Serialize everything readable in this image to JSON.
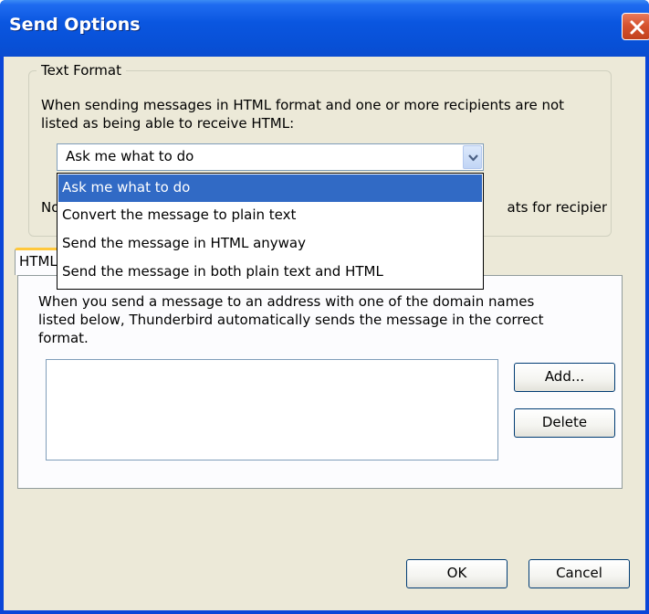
{
  "window": {
    "title": "Send Options",
    "colors": {
      "titlebar": "#0a56e0",
      "face": "#ece9d8",
      "selection": "#316ac5",
      "close": "#d6532f"
    }
  },
  "text_format": {
    "legend": "Text Format",
    "description_line1": "When sending messages in HTML format and one or more recipients are not",
    "description_line2": "listed as being able to receive HTML:",
    "combo_value": "Ask me what to do",
    "note_prefix": "Note",
    "note_suffix": "ats for recipients.",
    "options": [
      "Ask me what to do",
      "Convert the message to plain text",
      "Send the message in HTML anyway",
      "Send the message in both plain text and HTML"
    ],
    "selected_option": "Ask me what to do"
  },
  "tabs": {
    "active_label": "HTML D"
  },
  "domain_panel": {
    "description_line1": "When you send a message to an address with one of the domain names",
    "description_line2": "listed below, Thunderbird automatically sends the message in the correct",
    "description_line3": "format.",
    "add_label": "Add...",
    "delete_label": "Delete",
    "domains": []
  },
  "footer": {
    "ok_label": "OK",
    "cancel_label": "Cancel"
  },
  "icons": {
    "close": "close-icon",
    "dropdown": "chevron-down-icon"
  }
}
